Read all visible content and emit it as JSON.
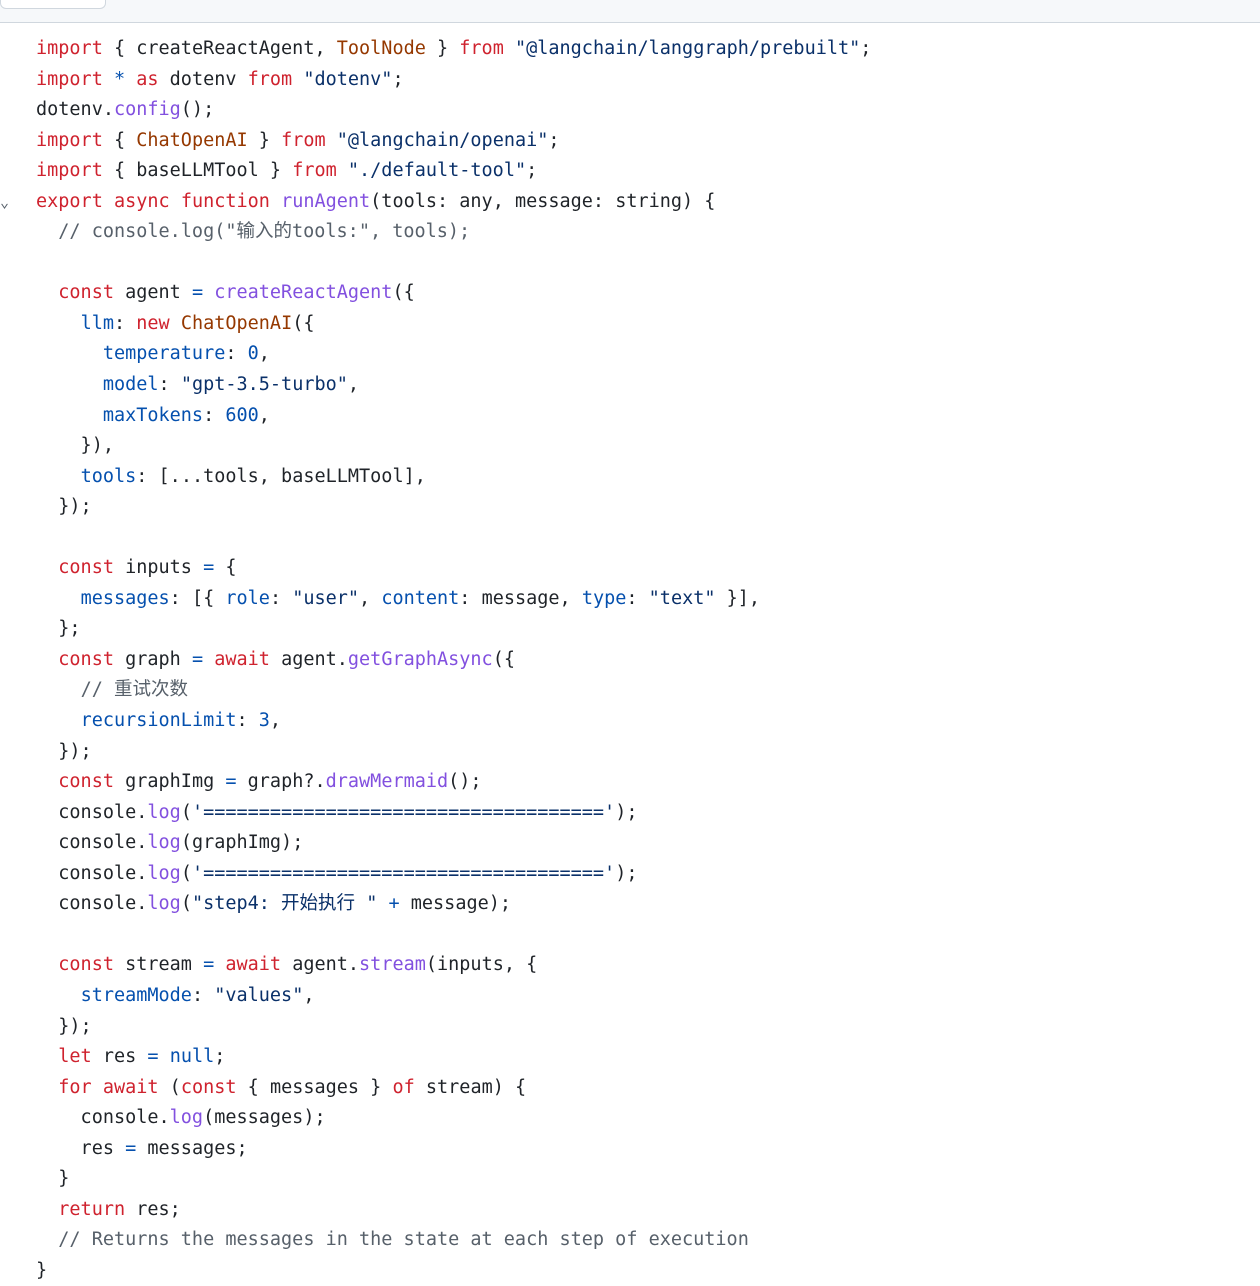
{
  "code": {
    "lines": [
      [
        {
          "t": "import",
          "c": "k"
        },
        {
          "t": " { "
        },
        {
          "t": "createReactAgent"
        },
        {
          "t": ", "
        },
        {
          "t": "ToolNode",
          "c": "cls"
        },
        {
          "t": " } "
        },
        {
          "t": "from",
          "c": "k"
        },
        {
          "t": " "
        },
        {
          "t": "\"@langchain/langgraph/prebuilt\"",
          "c": "s"
        },
        {
          "t": ";"
        }
      ],
      [
        {
          "t": "import",
          "c": "k"
        },
        {
          "t": " "
        },
        {
          "t": "*",
          "c": "p"
        },
        {
          "t": " "
        },
        {
          "t": "as",
          "c": "k"
        },
        {
          "t": " dotenv "
        },
        {
          "t": "from",
          "c": "k"
        },
        {
          "t": " "
        },
        {
          "t": "\"dotenv\"",
          "c": "s"
        },
        {
          "t": ";"
        }
      ],
      [
        {
          "t": "dotenv."
        },
        {
          "t": "config",
          "c": "f"
        },
        {
          "t": "();"
        }
      ],
      [
        {
          "t": "import",
          "c": "k"
        },
        {
          "t": " { "
        },
        {
          "t": "ChatOpenAI",
          "c": "cls"
        },
        {
          "t": " } "
        },
        {
          "t": "from",
          "c": "k"
        },
        {
          "t": " "
        },
        {
          "t": "\"@langchain/openai\"",
          "c": "s"
        },
        {
          "t": ";"
        }
      ],
      [
        {
          "t": "import",
          "c": "k"
        },
        {
          "t": " { baseLLMTool } "
        },
        {
          "t": "from",
          "c": "k"
        },
        {
          "t": " "
        },
        {
          "t": "\"./default-tool\"",
          "c": "s"
        },
        {
          "t": ";"
        }
      ],
      [
        {
          "t": "export",
          "c": "k"
        },
        {
          "t": " "
        },
        {
          "t": "async",
          "c": "k"
        },
        {
          "t": " "
        },
        {
          "t": "function",
          "c": "k"
        },
        {
          "t": " "
        },
        {
          "t": "runAgent",
          "c": "f"
        },
        {
          "t": "(tools: any, message: string) {"
        }
      ],
      [
        {
          "t": "  "
        },
        {
          "t": "// console.log(\"输入的tools:\", tools);",
          "c": "c"
        }
      ],
      [],
      [
        {
          "t": "  "
        },
        {
          "t": "const",
          "c": "k"
        },
        {
          "t": " agent "
        },
        {
          "t": "=",
          "c": "p"
        },
        {
          "t": " "
        },
        {
          "t": "createReactAgent",
          "c": "f"
        },
        {
          "t": "({"
        }
      ],
      [
        {
          "t": "    "
        },
        {
          "t": "llm",
          "c": "p"
        },
        {
          "t": ": "
        },
        {
          "t": "new",
          "c": "k"
        },
        {
          "t": " "
        },
        {
          "t": "ChatOpenAI",
          "c": "cls"
        },
        {
          "t": "({"
        }
      ],
      [
        {
          "t": "      "
        },
        {
          "t": "temperature",
          "c": "p"
        },
        {
          "t": ": "
        },
        {
          "t": "0",
          "c": "n"
        },
        {
          "t": ","
        }
      ],
      [
        {
          "t": "      "
        },
        {
          "t": "model",
          "c": "p"
        },
        {
          "t": ": "
        },
        {
          "t": "\"gpt-3.5-turbo\"",
          "c": "s"
        },
        {
          "t": ","
        }
      ],
      [
        {
          "t": "      "
        },
        {
          "t": "maxTokens",
          "c": "p"
        },
        {
          "t": ": "
        },
        {
          "t": "600",
          "c": "n"
        },
        {
          "t": ","
        }
      ],
      [
        {
          "t": "    }),"
        }
      ],
      [
        {
          "t": "    "
        },
        {
          "t": "tools",
          "c": "p"
        },
        {
          "t": ": [...tools, baseLLMTool],"
        }
      ],
      [
        {
          "t": "  });"
        }
      ],
      [],
      [
        {
          "t": "  "
        },
        {
          "t": "const",
          "c": "k"
        },
        {
          "t": " inputs "
        },
        {
          "t": "=",
          "c": "p"
        },
        {
          "t": " {"
        }
      ],
      [
        {
          "t": "    "
        },
        {
          "t": "messages",
          "c": "p"
        },
        {
          "t": ": [{ "
        },
        {
          "t": "role",
          "c": "p"
        },
        {
          "t": ": "
        },
        {
          "t": "\"user\"",
          "c": "s"
        },
        {
          "t": ", "
        },
        {
          "t": "content",
          "c": "p"
        },
        {
          "t": ": message, "
        },
        {
          "t": "type",
          "c": "p"
        },
        {
          "t": ": "
        },
        {
          "t": "\"text\"",
          "c": "s"
        },
        {
          "t": " }],"
        }
      ],
      [
        {
          "t": "  };"
        }
      ],
      [
        {
          "t": "  "
        },
        {
          "t": "const",
          "c": "k"
        },
        {
          "t": " graph "
        },
        {
          "t": "=",
          "c": "p"
        },
        {
          "t": " "
        },
        {
          "t": "await",
          "c": "k"
        },
        {
          "t": " agent."
        },
        {
          "t": "getGraphAsync",
          "c": "f"
        },
        {
          "t": "({"
        }
      ],
      [
        {
          "t": "    "
        },
        {
          "t": "// 重试次数",
          "c": "c"
        }
      ],
      [
        {
          "t": "    "
        },
        {
          "t": "recursionLimit",
          "c": "p"
        },
        {
          "t": ": "
        },
        {
          "t": "3",
          "c": "n"
        },
        {
          "t": ","
        }
      ],
      [
        {
          "t": "  });"
        }
      ],
      [
        {
          "t": "  "
        },
        {
          "t": "const",
          "c": "k"
        },
        {
          "t": " graphImg "
        },
        {
          "t": "=",
          "c": "p"
        },
        {
          "t": " graph?."
        },
        {
          "t": "drawMermaid",
          "c": "f"
        },
        {
          "t": "();"
        }
      ],
      [
        {
          "t": "  console."
        },
        {
          "t": "log",
          "c": "f"
        },
        {
          "t": "("
        },
        {
          "t": "'===================================='",
          "c": "s"
        },
        {
          "t": ");"
        }
      ],
      [
        {
          "t": "  console."
        },
        {
          "t": "log",
          "c": "f"
        },
        {
          "t": "(graphImg);"
        }
      ],
      [
        {
          "t": "  console."
        },
        {
          "t": "log",
          "c": "f"
        },
        {
          "t": "("
        },
        {
          "t": "'===================================='",
          "c": "s"
        },
        {
          "t": ");"
        }
      ],
      [
        {
          "t": "  console."
        },
        {
          "t": "log",
          "c": "f"
        },
        {
          "t": "("
        },
        {
          "t": "\"step4: 开始执行 \"",
          "c": "s"
        },
        {
          "t": " "
        },
        {
          "t": "+",
          "c": "p"
        },
        {
          "t": " message);"
        }
      ],
      [],
      [
        {
          "t": "  "
        },
        {
          "t": "const",
          "c": "k"
        },
        {
          "t": " stream "
        },
        {
          "t": "=",
          "c": "p"
        },
        {
          "t": " "
        },
        {
          "t": "await",
          "c": "k"
        },
        {
          "t": " agent."
        },
        {
          "t": "stream",
          "c": "f"
        },
        {
          "t": "(inputs, {"
        }
      ],
      [
        {
          "t": "    "
        },
        {
          "t": "streamMode",
          "c": "p"
        },
        {
          "t": ": "
        },
        {
          "t": "\"values\"",
          "c": "s"
        },
        {
          "t": ","
        }
      ],
      [
        {
          "t": "  });"
        }
      ],
      [
        {
          "t": "  "
        },
        {
          "t": "let",
          "c": "k"
        },
        {
          "t": " res "
        },
        {
          "t": "=",
          "c": "p"
        },
        {
          "t": " "
        },
        {
          "t": "null",
          "c": "n"
        },
        {
          "t": ";"
        }
      ],
      [
        {
          "t": "  "
        },
        {
          "t": "for",
          "c": "k"
        },
        {
          "t": " "
        },
        {
          "t": "await",
          "c": "k"
        },
        {
          "t": " ("
        },
        {
          "t": "const",
          "c": "k"
        },
        {
          "t": " { messages } "
        },
        {
          "t": "of",
          "c": "k"
        },
        {
          "t": " stream) {"
        }
      ],
      [
        {
          "t": "    console."
        },
        {
          "t": "log",
          "c": "f"
        },
        {
          "t": "(messages);"
        }
      ],
      [
        {
          "t": "    res "
        },
        {
          "t": "=",
          "c": "p"
        },
        {
          "t": " messages;"
        }
      ],
      [
        {
          "t": "  }"
        }
      ],
      [
        {
          "t": "  "
        },
        {
          "t": "return",
          "c": "k"
        },
        {
          "t": " res;"
        }
      ],
      [
        {
          "t": "  "
        },
        {
          "t": "// Returns the messages in the state at each step of execution",
          "c": "c"
        }
      ],
      [
        {
          "t": "}"
        }
      ]
    ]
  },
  "colors": {
    "keyword": "#cf222e",
    "function": "#8250df",
    "string": "#0a3069",
    "comment": "#57606a",
    "property": "#0550ae",
    "class": "#953800",
    "text": "#1f2328"
  },
  "gutter": {
    "fold_icon": "chevron-down-icon",
    "fold_glyph": "⌄",
    "fold_line_index": 5
  }
}
